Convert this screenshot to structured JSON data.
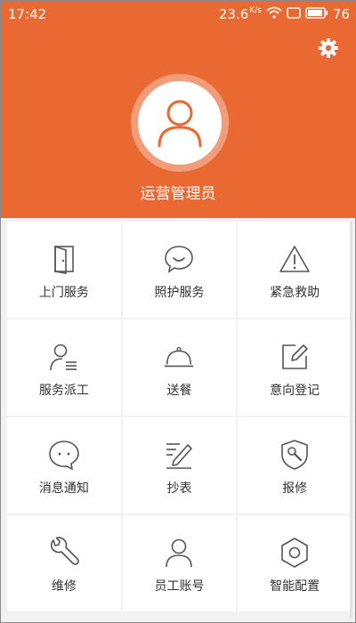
{
  "status_bar": {
    "time": "17:42",
    "network_speed": "23.6",
    "speed_unit": "K/s",
    "battery": "76"
  },
  "header": {
    "user_name": "运营管理员",
    "settings_icon": "gear-icon",
    "avatar_icon": "user-icon"
  },
  "colors": {
    "accent": "#ea6933",
    "icon_stroke": "#555555",
    "text": "#333333"
  },
  "menu": [
    {
      "label": "上门服务",
      "icon": "door-icon"
    },
    {
      "label": "照护服务",
      "icon": "chat-smile-icon"
    },
    {
      "label": "紧急救助",
      "icon": "warning-icon"
    },
    {
      "label": "服务派工",
      "icon": "user-list-icon"
    },
    {
      "label": "送餐",
      "icon": "food-cloche-icon"
    },
    {
      "label": "意向登记",
      "icon": "edit-icon"
    },
    {
      "label": "消息通知",
      "icon": "message-icon"
    },
    {
      "label": "抄表",
      "icon": "meter-reading-icon"
    },
    {
      "label": "报修",
      "icon": "repair-report-icon"
    },
    {
      "label": "维修",
      "icon": "wrench-icon"
    },
    {
      "label": "员工账号",
      "icon": "user-icon"
    },
    {
      "label": "智能配置",
      "icon": "hexagon-settings-icon"
    }
  ]
}
